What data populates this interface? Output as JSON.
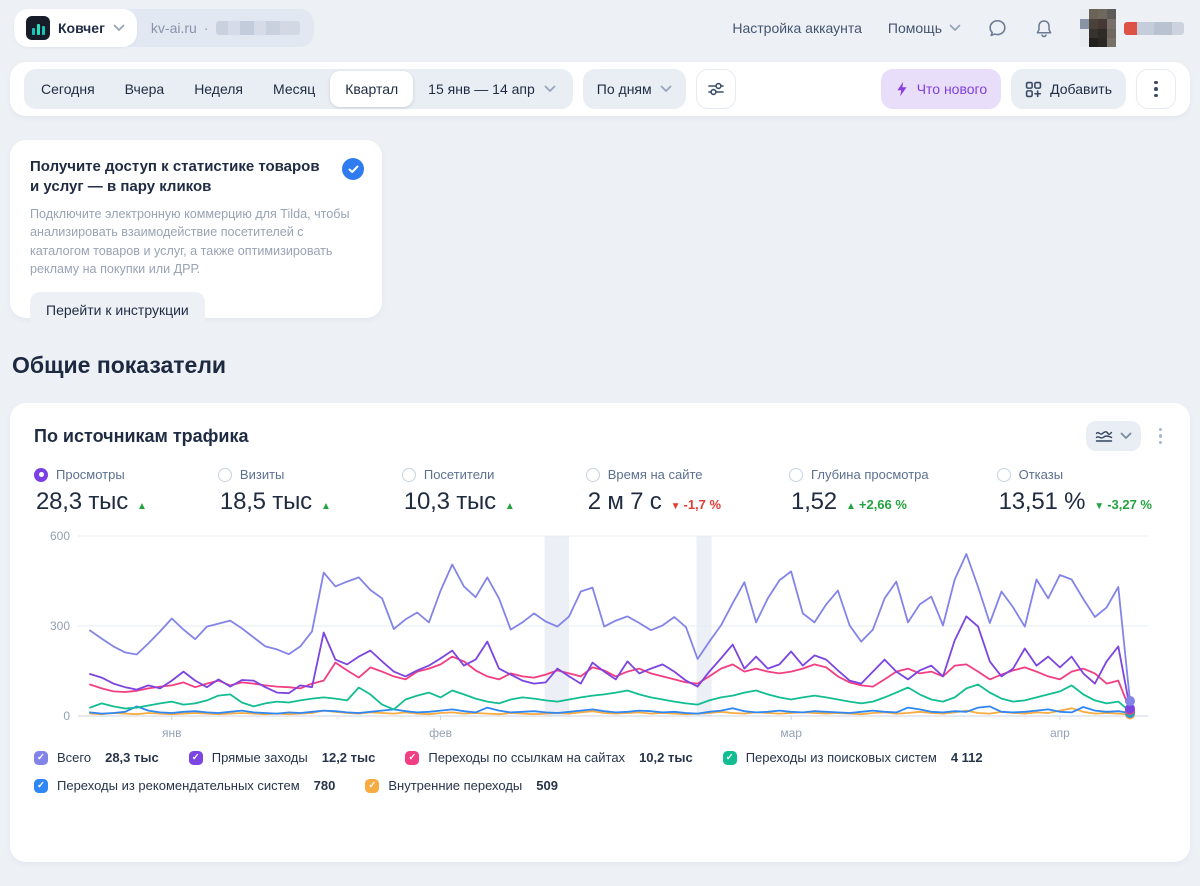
{
  "topbar": {
    "counter_name": "Ковчег",
    "site": "kv-ai.ru",
    "dot": "·",
    "account_settings": "Настройка аккаунта",
    "help": "Помощь"
  },
  "toolbar": {
    "periods": [
      "Сегодня",
      "Вчера",
      "Неделя",
      "Месяц",
      "Квартал"
    ],
    "selected_period": "Квартал",
    "date_range": "15 янв — 14 апр",
    "granularity": "По дням",
    "whats_new_label": "Что нового",
    "add_label": "Добавить"
  },
  "promo": {
    "title": "Получите доступ к статистике товаров и услуг — в пару кликов",
    "body": "Подключите электронную коммерцию для Tilda, чтобы анализировать взаимодействие посетителей с каталогом товаров и услуг, а также оптимизировать рекламу на покупки или ДРР.",
    "cta": "Перейти к инструкции"
  },
  "section_title": "Общие показатели",
  "widget": {
    "title": "По источникам трафика",
    "metrics": [
      {
        "label": "Просмотры",
        "value": "28,3 тыс",
        "arrow": "▲",
        "delta": "",
        "trend_color": "#23a33f",
        "selected": true
      },
      {
        "label": "Визиты",
        "value": "18,5 тыс",
        "arrow": "▲",
        "delta": "",
        "trend_color": "#23a33f",
        "selected": false
      },
      {
        "label": "Посетители",
        "value": "10,3 тыс",
        "arrow": "▲",
        "delta": "",
        "trend_color": "#23a33f",
        "selected": false
      },
      {
        "label": "Время на сайте",
        "value": "2 м 7 с",
        "arrow": "▼",
        "delta": "-1,7 %",
        "trend_color": "#e23d32",
        "selected": false
      },
      {
        "label": "Глубина просмотра",
        "value": "1,52",
        "arrow": "▲",
        "delta": "+2,66 %",
        "trend_color": "#23a33f",
        "selected": false
      },
      {
        "label": "Отказы",
        "value": "13,51 %",
        "arrow": "▼",
        "delta": "-3,27 %",
        "trend_color": "#23a33f",
        "selected": false
      }
    ]
  },
  "chart_data": {
    "type": "line",
    "title": "По источникам трафика",
    "x_range": [
      "15 янв",
      "14 апр"
    ],
    "y_max": 600,
    "y_ticks": [
      0,
      300,
      600
    ],
    "x_ticks": [
      {
        "label": "янв",
        "day": 7
      },
      {
        "label": "фев",
        "day": 30
      },
      {
        "label": "мар",
        "day": 60
      },
      {
        "label": "апр",
        "day": 83
      }
    ],
    "highlight_bands": [
      {
        "from_day": 38.9,
        "to_day": 41.0
      },
      {
        "from_day": 51.9,
        "to_day": 53.2
      }
    ],
    "series": [
      {
        "name": "Всего",
        "total": "28,3 тыс",
        "color": "#8384e8",
        "values": [
          285,
          258,
          232,
          212,
          205,
          242,
          282,
          325,
          288,
          256,
          298,
          308,
          318,
          292,
          262,
          232,
          222,
          206,
          232,
          282,
          478,
          432,
          448,
          462,
          420,
          392,
          290,
          322,
          345,
          312,
          418,
          505,
          432,
          396,
          462,
          392,
          288,
          312,
          342,
          315,
          298,
          332,
          415,
          428,
          298,
          318,
          332,
          310,
          286,
          302,
          330,
          296,
          190,
          248,
          302,
          376,
          446,
          312,
          392,
          452,
          482,
          342,
          312,
          372,
          418,
          302,
          248,
          288,
          392,
          448,
          312,
          372,
          398,
          302,
          455,
          540,
          430,
          310,
          415,
          362,
          298,
          455,
          392,
          470,
          455,
          390,
          330,
          362,
          430,
          50
        ]
      },
      {
        "name": "Прямые заходы",
        "total": "12,2 тыс",
        "color": "#7c44e0",
        "values": [
          140,
          128,
          108,
          96,
          88,
          102,
          92,
          118,
          148,
          118,
          96,
          122,
          98,
          120,
          118,
          96,
          78,
          76,
          102,
          96,
          278,
          188,
          172,
          198,
          218,
          182,
          148,
          132,
          152,
          168,
          192,
          218,
          168,
          188,
          248,
          158,
          138,
          118,
          108,
          112,
          158,
          132,
          108,
          178,
          148,
          122,
          182,
          142,
          158,
          172,
          148,
          118,
          98,
          148,
          192,
          238,
          158,
          198,
          158,
          172,
          215,
          168,
          202,
          188,
          152,
          118,
          108,
          148,
          188,
          148,
          122,
          152,
          168,
          132,
          252,
          332,
          298,
          182,
          132,
          158,
          225,
          168,
          198,
          162,
          198,
          142,
          108,
          182,
          232,
          25
        ]
      },
      {
        "name": "Переходы по ссылкам на сайтах",
        "total": "10,2 тыс",
        "color": "#f23e82",
        "values": [
          105,
          92,
          82,
          80,
          84,
          92,
          98,
          102,
          112,
          96,
          108,
          118,
          102,
          112,
          108,
          102,
          98,
          96,
          92,
          108,
          118,
          178,
          152,
          128,
          162,
          148,
          132,
          122,
          148,
          158,
          172,
          198,
          182,
          152,
          132,
          122,
          142,
          132,
          128,
          138,
          152,
          142,
          132,
          162,
          152,
          132,
          148,
          158,
          142,
          132,
          122,
          112,
          108,
          132,
          158,
          172,
          148,
          158,
          148,
          142,
          148,
          158,
          172,
          162,
          132,
          112,
          102,
          98,
          122,
          148,
          158,
          142,
          148,
          132,
          168,
          172,
          148,
          122,
          138,
          152,
          162,
          148,
          132,
          122,
          148,
          158,
          142,
          108,
          118,
          20
        ]
      },
      {
        "name": "Переходы из поисковых систем",
        "total": "4 112",
        "color": "#12bd92",
        "values": [
          28,
          42,
          32,
          25,
          28,
          35,
          42,
          48,
          38,
          42,
          52,
          68,
          72,
          45,
          32,
          42,
          48,
          45,
          52,
          58,
          62,
          58,
          52,
          95,
          72,
          38,
          22,
          55,
          68,
          78,
          62,
          85,
          72,
          58,
          48,
          42,
          55,
          62,
          58,
          52,
          48,
          55,
          62,
          68,
          72,
          78,
          85,
          72,
          62,
          55,
          48,
          42,
          38,
          52,
          62,
          68,
          78,
          85,
          72,
          62,
          55,
          62,
          68,
          62,
          55,
          48,
          42,
          48,
          62,
          78,
          95,
          72,
          55,
          48,
          62,
          92,
          105,
          78,
          58,
          48,
          52,
          62,
          72,
          82,
          102,
          72,
          52,
          42,
          48,
          15
        ]
      },
      {
        "name": "Переходы из рекомендательных систем",
        "total": "780",
        "color": "#2f87f5",
        "values": [
          12,
          8,
          10,
          14,
          32,
          18,
          12,
          10,
          14,
          16,
          12,
          10,
          14,
          18,
          12,
          10,
          8,
          12,
          10,
          14,
          18,
          16,
          12,
          10,
          14,
          18,
          22,
          16,
          12,
          14,
          18,
          22,
          16,
          12,
          28,
          18,
          12,
          14,
          16,
          12,
          10,
          14,
          18,
          22,
          16,
          12,
          14,
          18,
          16,
          12,
          14,
          10,
          8,
          14,
          18,
          26,
          16,
          12,
          14,
          18,
          14,
          12,
          16,
          14,
          12,
          10,
          14,
          18,
          14,
          12,
          28,
          22,
          14,
          12,
          16,
          14,
          28,
          32,
          14,
          12,
          14,
          18,
          22,
          14,
          12,
          30,
          18,
          14,
          16,
          10
        ]
      },
      {
        "name": "Внутренние переходы",
        "total": "509",
        "color": "#f6ab43",
        "values": [
          8,
          6,
          10,
          8,
          6,
          10,
          8,
          6,
          8,
          10,
          8,
          6,
          8,
          10,
          8,
          6,
          8,
          6,
          8,
          10,
          18,
          14,
          10,
          8,
          12,
          10,
          8,
          12,
          8,
          6,
          10,
          12,
          8,
          10,
          8,
          6,
          10,
          8,
          6,
          8,
          10,
          8,
          12,
          16,
          10,
          8,
          10,
          12,
          8,
          10,
          8,
          6,
          8,
          10,
          14,
          10,
          8,
          12,
          10,
          8,
          10,
          12,
          10,
          8,
          10,
          8,
          6,
          10,
          12,
          8,
          10,
          14,
          10,
          8,
          12,
          18,
          10,
          8,
          14,
          10,
          8,
          12,
          10,
          18,
          26,
          14,
          8,
          10,
          8,
          5
        ]
      }
    ]
  }
}
